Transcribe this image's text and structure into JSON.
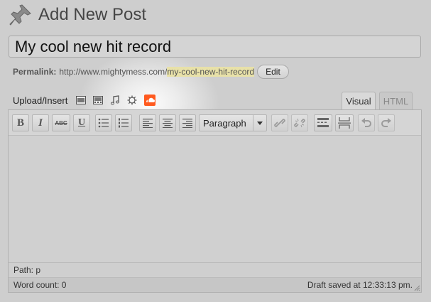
{
  "header": {
    "title": "Add New Post",
    "icon": "pushpin-icon"
  },
  "post_title": {
    "value": "My cool new hit record"
  },
  "permalink": {
    "label": "Permalink:",
    "base": "http://www.mightymess.com/",
    "slug": "my-cool-new-hit-record",
    "edit_label": "Edit"
  },
  "media": {
    "label": "Upload/Insert",
    "icons": [
      "image-icon",
      "video-icon",
      "audio-icon",
      "media-icon",
      "soundcloud-icon"
    ],
    "soundcloud_color": "#ff5a1f"
  },
  "tabs": {
    "visual": "Visual",
    "html": "HTML"
  },
  "toolbar": {
    "bold": "B",
    "italic": "I",
    "strike": "ABC",
    "underline": "U",
    "format_value": "Paragraph",
    "buttons": [
      "bold-button",
      "italic-button",
      "strikethrough-button",
      "underline-button",
      "bullet-list-button",
      "numbered-list-button",
      "align-left-button",
      "align-center-button",
      "align-right-button",
      "format-select",
      "link-button",
      "unlink-button",
      "more-tag-button",
      "page-break-button",
      "undo-button",
      "redo-button"
    ]
  },
  "editor": {
    "path_label": "Path: p",
    "word_count": "Word count: 0",
    "draft_status": "Draft saved at 12:33:13 pm."
  }
}
